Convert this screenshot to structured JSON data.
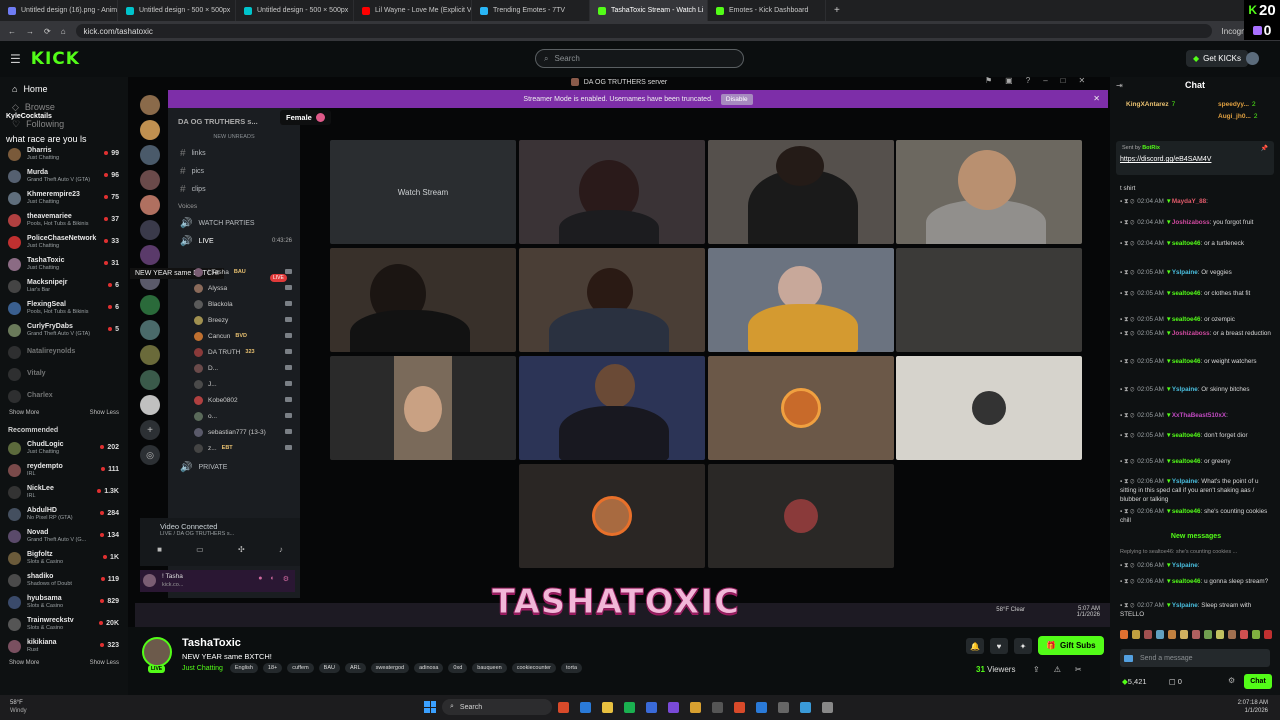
{
  "browser": {
    "tabs": [
      {
        "label": "Untitled design (16).png - Anim",
        "color": "#6f7cf4",
        "active": false
      },
      {
        "label": "Untitled design - 500 × 500px",
        "color": "#00c4cc",
        "active": false
      },
      {
        "label": "Untitled design - 500 × 500px",
        "color": "#00c4cc",
        "active": false
      },
      {
        "label": "Lil Wayne - Love Me (Explicit V",
        "color": "#ff0000",
        "active": false
      },
      {
        "label": "Trending Emotes - 7TV",
        "color": "#29b6f6",
        "active": false
      },
      {
        "label": "TashaToxic Stream - Watch Li",
        "color": "#53fc18",
        "active": true
      },
      {
        "label": "Emotes - Kick Dashboard",
        "color": "#53fc18",
        "active": false
      }
    ],
    "url": "kick.com/tashatoxic",
    "incognito_label": "Incognito",
    "corner_badge": "20",
    "corner_count": "0"
  },
  "header": {
    "logo": "KICK",
    "search_placeholder": "Search",
    "get_kicks": "Get KICKs"
  },
  "sidebar": {
    "home": "Home",
    "browse": "Browse",
    "following": "Following",
    "overlay_user": "KyleCocktails",
    "overlay_msg": "what race are you ls",
    "following_list": [
      {
        "name": "Dharris",
        "game": "Just Chatting",
        "viewers": "99",
        "color": "#7a5a3a"
      },
      {
        "name": "Murda",
        "game": "Grand Theft Auto V (GTA)",
        "viewers": "96",
        "color": "#556070"
      },
      {
        "name": "Khmerempire23",
        "game": "Just Chatting",
        "viewers": "75",
        "color": "#5f6e7c"
      },
      {
        "name": "theavemariee",
        "game": "Pools, Hot Tubs & Bikinis",
        "viewers": "37",
        "color": "#b04040"
      },
      {
        "name": "PoliceChaseNetwork",
        "game": "Just Chatting",
        "viewers": "33",
        "color": "#c03030"
      },
      {
        "name": "TashaToxic",
        "game": "Just Chatting",
        "viewers": "31",
        "color": "#8b6b84"
      },
      {
        "name": "Macksnipejr",
        "game": "Liar's Bar",
        "viewers": "6",
        "color": "#444"
      },
      {
        "name": "FlexingSeal",
        "game": "Pools, Hot Tubs & Bikinis",
        "viewers": "6",
        "color": "#3a5f8f"
      },
      {
        "name": "CurlyFryDabs",
        "game": "Grand Theft Auto V (GTA)",
        "viewers": "5",
        "color": "#6a7a5a"
      }
    ],
    "offline": [
      "Natalireynolds",
      "Vitaly",
      "Charlex"
    ],
    "show_more": "Show More",
    "show_less": "Show Less",
    "recommended_title": "Recommended",
    "recommended": [
      {
        "name": "ChudLogic",
        "game": "Just Chatting",
        "viewers": "202",
        "color": "#5c6a3c"
      },
      {
        "name": "reydempto",
        "game": "IRL",
        "viewers": "111",
        "color": "#7a4a4a"
      },
      {
        "name": "NickLee",
        "game": "IRL",
        "viewers": "1.3K",
        "color": "#333"
      },
      {
        "name": "AbdulHD",
        "game": "No Pixel RP (GTA)",
        "viewers": "284",
        "color": "#444f5f"
      },
      {
        "name": "Novad",
        "game": "Grand Theft Auto V (G...",
        "viewers": "134",
        "color": "#5a4a6a"
      },
      {
        "name": "Bigfoltz",
        "game": "Slots & Casino",
        "viewers": "1K",
        "color": "#6a5a3a"
      },
      {
        "name": "shadiko",
        "game": "Shadows of Doubt",
        "viewers": "119",
        "color": "#4a4a4a"
      },
      {
        "name": "hyubsama",
        "game": "Slots & Casino",
        "viewers": "829",
        "color": "#3a4a6a"
      },
      {
        "name": "Trainwreckstv",
        "game": "Slots & Casino",
        "viewers": "20K",
        "color": "#555"
      },
      {
        "name": "kikikiana",
        "game": "Rust",
        "viewers": "323",
        "color": "#7a5060"
      }
    ]
  },
  "discord": {
    "window_title": "DA OG TRUTHERS server",
    "server_name": "DA OG TRUTHERS s...",
    "tooltip": "Female",
    "banner": "Streamer Mode is enabled. Usernames have been truncated.",
    "disable": "Disable",
    "new_unreads": "NEW UNREADS",
    "channels": [
      "links",
      "pics",
      "clips"
    ],
    "voices_label": "Voices",
    "voice_channels": [
      "WATCH PARTIES",
      "LIVE"
    ],
    "live_badge": "LIVE",
    "live_timer": "0:43:26",
    "stream_tooltip": "NEW YEAR same BXTCH!",
    "members": [
      {
        "name": "! Tasha",
        "tag": "BAU",
        "color": "#7a5d73"
      },
      {
        "name": "Alyssa",
        "tag": "",
        "color": "#8a6a5a"
      },
      {
        "name": "Blackola",
        "tag": "",
        "color": "#5a5a5a"
      },
      {
        "name": "Breezy",
        "tag": "",
        "color": "#a09050"
      },
      {
        "name": "Cancun",
        "tag": "BVD",
        "color": "#c07030"
      },
      {
        "name": "DA TRUTH",
        "tag": "323",
        "color": "#8a3a3a"
      },
      {
        "name": "D...",
        "tag": "",
        "color": "#6a4a4a"
      },
      {
        "name": "J...",
        "tag": "",
        "color": "#4a4a4a"
      },
      {
        "name": "Kobe0802",
        "tag": "",
        "color": "#b04040"
      },
      {
        "name": "o...",
        "tag": "",
        "color": "#5a6a5a"
      },
      {
        "name": "sebastian777 (13-3)",
        "tag": "",
        "color": "#5a5a6a"
      },
      {
        "name": "z...",
        "tag": "EBT",
        "color": "#444"
      }
    ],
    "private": "PRIVATE",
    "video_connected": "Video Connected",
    "vc_sub": "LIVE / DA OG TRUTHERS s...",
    "user_name": "! Tasha",
    "user_sub": "kick.co...",
    "watch_stream": "Watch Stream"
  },
  "overlay_title": "TASHATOXIC",
  "windows_overlay": {
    "weather": "58°F Clear",
    "time": "5:07 AM",
    "date": "1/1/2026"
  },
  "stream": {
    "streamer": "TashaToxic",
    "title": "NEW YEAR same BXTCH!",
    "category": "Just Chatting",
    "tags": [
      "English",
      "18+",
      "cuffem",
      "BAU",
      "ARL",
      "sweatergod",
      "adinosa",
      "0xd",
      "bauqueen",
      "cookiecounter",
      "torta"
    ],
    "gift_subs": "Gift Subs",
    "viewers_num": "31",
    "viewers_label": "Viewers"
  },
  "chat": {
    "title": "Chat",
    "top_gifters": [
      {
        "name": "KingXAntarez",
        "count": "7"
      },
      {
        "name": "speedyy...",
        "count": "2"
      },
      {
        "name": "Augi_jh0...",
        "count": "2"
      }
    ],
    "pinned_from": "Sent by",
    "pinned_user": "BotRix",
    "pinned_link": "https://discord.gg/eB4SAM4V",
    "messages": [
      {
        "time": "",
        "user": "",
        "color": "#ddd",
        "text": "t shirt"
      },
      {
        "time": "02:04 AM",
        "user": "MaydaY_88",
        "color": "#e05a6a",
        "text": ""
      },
      {
        "time": "02:04 AM",
        "user": "Joshizaboss",
        "color": "#d04aa0",
        "text": "you forgot fruit"
      },
      {
        "time": "02:04 AM",
        "user": "sealtoe46",
        "color": "#53fc18",
        "text": "or a turtleneck"
      },
      {
        "time": "02:05 AM",
        "user": "Yslpaine",
        "color": "#4ac0e0",
        "text": "Or veggies"
      },
      {
        "time": "02:05 AM",
        "user": "sealtoe46",
        "color": "#53fc18",
        "text": "or clothes that fit"
      },
      {
        "time": "02:05 AM",
        "user": "sealtoe46",
        "color": "#53fc18",
        "text": "or ozempic"
      },
      {
        "time": "02:05 AM",
        "user": "Joshizaboss",
        "color": "#d04aa0",
        "text": "or a breast reduction"
      },
      {
        "time": "02:05 AM",
        "user": "sealtoe46",
        "color": "#53fc18",
        "text": "or weight watchers"
      },
      {
        "time": "02:05 AM",
        "user": "Yslpaine",
        "color": "#4ac0e0",
        "text": "Or skinny bitches"
      },
      {
        "time": "02:05 AM",
        "user": "XxThaBeast510xX",
        "color": "#c04ac0",
        "text": ""
      },
      {
        "time": "02:05 AM",
        "user": "sealtoe46",
        "color": "#53fc18",
        "text": "don't forget dior"
      },
      {
        "time": "02:05 AM",
        "user": "sealtoe46",
        "color": "#53fc18",
        "text": "or greeny"
      },
      {
        "time": "02:06 AM",
        "user": "Yslpaine",
        "color": "#4ac0e0",
        "text": "What's the point of u sitting in this sped call if you aren't shaking aas / blubber or talking"
      },
      {
        "time": "02:06 AM",
        "user": "sealtoe46",
        "color": "#53fc18",
        "text": "she's counting cookies chill"
      }
    ],
    "new_messages": "New messages",
    "reply_to": "Replying to sealtoe46: she's counting cookies ...",
    "messages2": [
      {
        "time": "02:06 AM",
        "user": "Yslpaine",
        "color": "#4ac0e0",
        "text": ""
      },
      {
        "time": "02:06 AM",
        "user": "sealtoe46",
        "color": "#53fc18",
        "text": "u gonna sleep stream?"
      },
      {
        "time": "02:07 AM",
        "user": "Yslpaine",
        "color": "#4ac0e0",
        "text": "Sleep stream with STELLO"
      }
    ],
    "input_placeholder": "Send a message",
    "kicks_balance": "5,421",
    "points": "0",
    "chat_button": "Chat"
  },
  "taskbar": {
    "weather_temp": "58°F",
    "weather_desc": "Windy",
    "search": "Search",
    "time": "2:07:18 AM",
    "date": "1/1/2026"
  }
}
